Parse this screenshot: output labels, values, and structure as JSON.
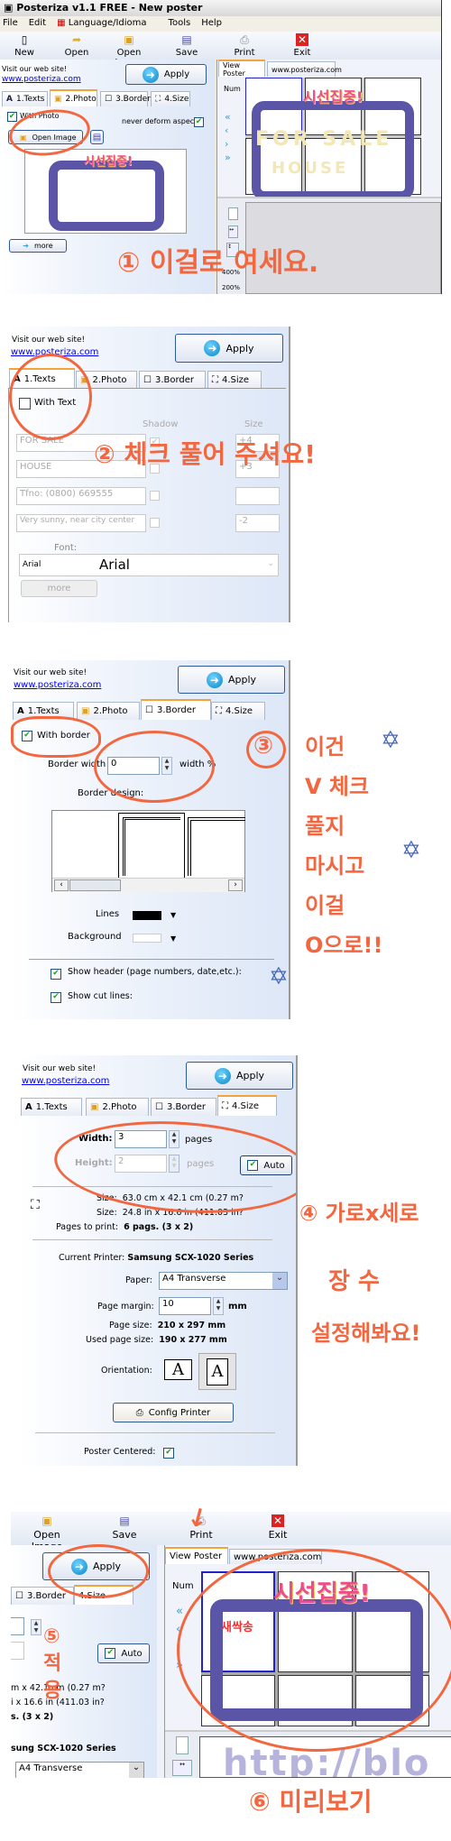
{
  "app": {
    "title": "Posteriza v1.1 FREE - New poster",
    "menu": [
      "File",
      "Edit",
      "Language/Idioma",
      "Tools",
      "Help"
    ],
    "toolbar": {
      "new": "New",
      "open": "Open",
      "open_image": "Open Image",
      "save": "Save",
      "print": "Print",
      "exit": "Exit"
    },
    "visit": "Visit our web site!",
    "link": "www.posteriza.com",
    "apply": "Apply",
    "tabs": [
      "1.Texts",
      "2.Photo",
      "3.Border",
      "4.Size"
    ],
    "view_tabs": [
      "View Poster",
      "www.posteriza.com"
    ],
    "num": "Num",
    "zoom_levels": [
      "400%",
      "200%"
    ],
    "more": "more"
  },
  "photo_tab": {
    "with_photo": "With Photo",
    "with_photo_checked": true,
    "never_deform": "never deform aspect",
    "never_deform_checked": true,
    "open_image": "Open Image"
  },
  "texts_tab": {
    "with_text": "With Text",
    "with_text_checked": false,
    "shadow": "Shadow",
    "size": "Size",
    "rows": [
      {
        "text": "FOR SALE",
        "shadow": true,
        "size": "+4"
      },
      {
        "text": "HOUSE",
        "shadow": false,
        "size": "+3"
      },
      {
        "text": "Tfno: (0800) 669555",
        "shadow": false,
        "size": ""
      },
      {
        "text": "Very sunny, near city center",
        "shadow": false,
        "size": "-2"
      }
    ],
    "font_label": "Font:",
    "font_name": "Arial",
    "font_preview": "Arial"
  },
  "border_tab": {
    "with_border": "With border",
    "with_border_checked": true,
    "border_width": "Border width",
    "width_value": "0",
    "width_unit": "width %",
    "border_design": "Border design:",
    "lines": "Lines",
    "lines_color": "#000000",
    "background": "Background",
    "background_color": "#ffffff",
    "show_header": "Show header (page numbers, date,etc.):",
    "show_cut_lines": "Show cut lines:"
  },
  "size_tab": {
    "width_label": "Width:",
    "width": "3",
    "height_label": "Height:",
    "height": "2",
    "pages": "pages",
    "auto": "Auto",
    "auto_checked": true,
    "size_label": "Size:",
    "size_cm": "63.0 cm x 42.1 cm (0.27 m?",
    "size_in": "24.8 in x 16.6 in (411.03 in?",
    "pages_to_print_label": "Pages to print:",
    "pages_to_print": "6 pags. (3 x 2)",
    "printer_label": "Current Printer:",
    "printer": "Samsung SCX-1020 Series",
    "paper_label": "Paper:",
    "paper": "A4 Transverse",
    "margin_label": "Page margin:",
    "margin": "10",
    "margin_unit": "mm",
    "page_size_label": "Page size:",
    "page_size": "210 x 297 mm",
    "used_label": "Used page size:",
    "used_size": "190 x 277 mm",
    "orientation_label": "Orientation:",
    "config_printer": "Config Printer",
    "centered_label": "Poster Centered:",
    "centered_checked": true
  },
  "step5": {
    "size_cm": "m x 42.1 cm (0.27 m?",
    "size_in": "i x 16.6 in (411.03 in?",
    "pages": "s. (3 x 2)",
    "printer": "sung SCX-1020 Series",
    "paper": "A4 Transverse",
    "watermark": "http://blo"
  },
  "poster": {
    "title": "시선집중!",
    "sign": "FOR SALE",
    "sign2": "HOUSE",
    "badge": "새싹송"
  },
  "annotations": {
    "a1": "① 이걸로 여세요.",
    "a2": "② 체크 풀어 주셔요!",
    "a3": "③",
    "a3_text": [
      "이건",
      "V 체크",
      "풀지",
      "마시고",
      "이걸",
      "O으로!!"
    ],
    "a4": "④ 가로x세로",
    "a4_2": "장 수",
    "a4_3": "설정해봐요!",
    "a5": "⑤ 적용",
    "a6": "⑥ 미리보기"
  },
  "colors": {
    "annotation": "#f2673f",
    "star": "#4466bb",
    "accent_tab": "#f2a33a",
    "poster_frame": "#5b55a8"
  }
}
